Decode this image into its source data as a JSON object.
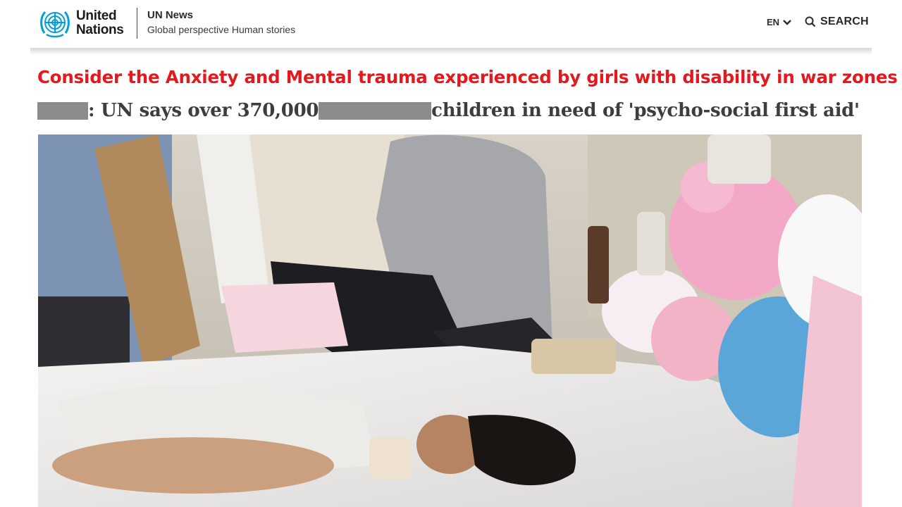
{
  "header": {
    "org_name_line1": "United",
    "org_name_line2": "Nations",
    "site_title": "UN News",
    "tagline": "Global perspective Human stories",
    "language": "EN",
    "search_label": "SEARCH"
  },
  "overlay_headline": "Consider the Anxiety and Mental trauma experienced by girls with disability in war zones",
  "article": {
    "headline_part1": ": UN says over 370,000 ",
    "headline_part2": "children in need of 'psycho-social first aid'"
  },
  "icons": [
    "un-emblem-icon",
    "chevron-down-icon",
    "search-icon"
  ],
  "colors": {
    "overlay_headline": "#e5181e",
    "un_blue": "#009edb",
    "redaction": "#8c8c8c"
  }
}
